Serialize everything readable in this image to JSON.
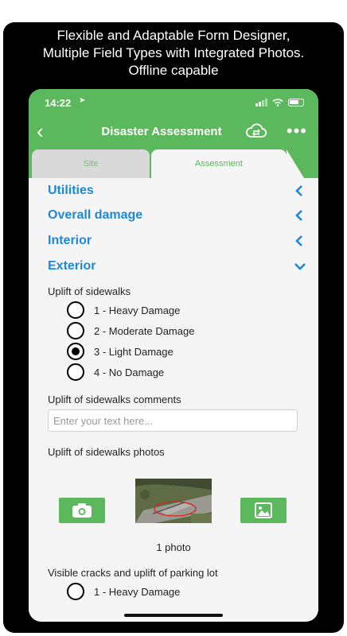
{
  "promo": {
    "line1": "Flexible and Adaptable Form Designer,",
    "line2": "Multiple Field Types with Integrated Photos.",
    "line3": "Offline capable"
  },
  "statusbar": {
    "time": "14:22"
  },
  "navbar": {
    "title": "Disaster Assessment",
    "more_label": "•••"
  },
  "tabs": [
    {
      "label": "Site",
      "active": false
    },
    {
      "label": "Assessment",
      "active": true
    }
  ],
  "sections": [
    {
      "label": "Utilities",
      "expanded": false
    },
    {
      "label": "Overall damage",
      "expanded": false
    },
    {
      "label": "Interior",
      "expanded": false
    },
    {
      "label": "Exterior",
      "expanded": true
    }
  ],
  "exterior": {
    "question1": {
      "label": "Uplift of sidewalks",
      "options": [
        "1 - Heavy Damage",
        "2 - Moderate Damage",
        "3 - Light Damage",
        "4 - No Damage"
      ],
      "selected_index": 2
    },
    "comments": {
      "label": "Uplift of sidewalks comments",
      "placeholder": "Enter your text here...",
      "value": ""
    },
    "photos": {
      "label": "Uplift of sidewalks photos",
      "count_text": "1 photo"
    },
    "question2": {
      "label": "Visible cracks and uplift of parking lot",
      "options": [
        "1 - Heavy Damage"
      ]
    }
  },
  "colors": {
    "accent_green": "#5cb85c",
    "section_blue": "#1e88d8",
    "frame": "#000000"
  },
  "icons": {
    "back": "chevron-left-icon",
    "sync": "cloud-sync-icon",
    "more": "more-dots-icon",
    "collapsed": "chevron-left-icon",
    "expanded": "chevron-down-icon",
    "camera": "camera-icon",
    "gallery": "image-gallery-icon"
  }
}
